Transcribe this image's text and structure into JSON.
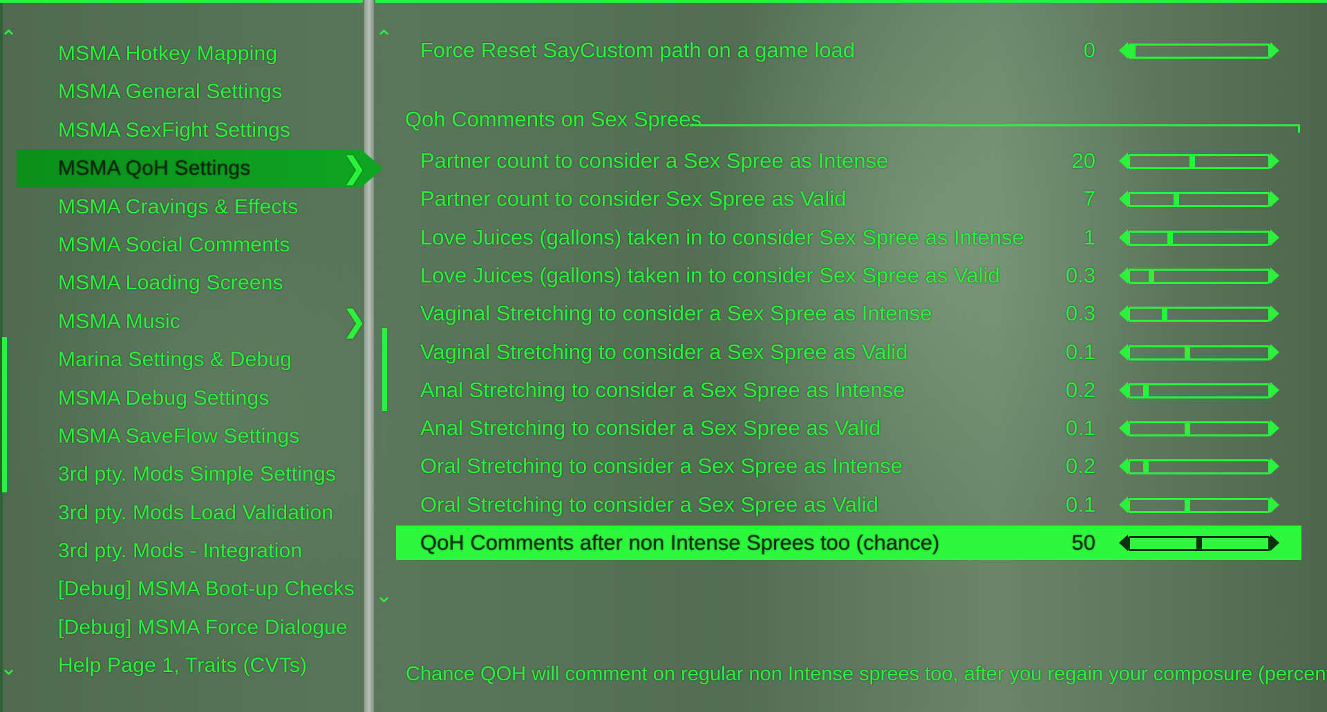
{
  "left_menu": {
    "items": [
      {
        "label": "MSMA Hotkey Mapping"
      },
      {
        "label": "MSMA General Settings"
      },
      {
        "label": "MSMA SexFight Settings"
      },
      {
        "label": "MSMA QoH Settings"
      },
      {
        "label": "MSMA Cravings & Effects"
      },
      {
        "label": "MSMA Social Comments"
      },
      {
        "label": "MSMA Loading Screens"
      },
      {
        "label": "MSMA Music"
      },
      {
        "label": "Marina Settings & Debug"
      },
      {
        "label": "MSMA Debug Settings"
      },
      {
        "label": "MSMA SaveFlow Settings"
      },
      {
        "label": "3rd pty. Mods Simple Settings"
      },
      {
        "label": "3rd pty. Mods Load Validation"
      },
      {
        "label": "3rd pty. Mods - Integration"
      },
      {
        "label": "[Debug] MSMA Boot-up Checks"
      },
      {
        "label": "[Debug] MSMA Force Dialogue"
      },
      {
        "label": "Help Page 1, Traits (CVTs)"
      }
    ],
    "selected_index": 3
  },
  "settings": {
    "top_row": {
      "label": "Force Reset SayCustom path on a game load",
      "value": "0",
      "slider_fraction": 0.0
    },
    "section_title": "Qoh Comments on Sex Sprees",
    "rows": [
      {
        "label": "Partner count to consider a Sex Spree as Intense",
        "value": "20",
        "slider_fraction": 0.45
      },
      {
        "label": "Partner count to consider Sex Spree as Valid",
        "value": "7",
        "slider_fraction": 0.33
      },
      {
        "label": "Love Juices (gallons) taken in to consider Sex Spree as Intense",
        "value": "1",
        "slider_fraction": 0.28
      },
      {
        "label": "Love Juices (gallons) taken in to consider Sex Spree as Valid",
        "value": "0.3",
        "slider_fraction": 0.14
      },
      {
        "label": "Vaginal Stretching to consider a Sex Spree as Intense",
        "value": "0.3",
        "slider_fraction": 0.24
      },
      {
        "label": "Vaginal Stretching to consider a Sex Spree as Valid",
        "value": "0.1",
        "slider_fraction": 0.41
      },
      {
        "label": "Anal Stretching to consider a Sex Spree as Intense",
        "value": "0.2",
        "slider_fraction": 0.1
      },
      {
        "label": "Anal Stretching to consider a Sex Spree as Valid",
        "value": "0.1",
        "slider_fraction": 0.41
      },
      {
        "label": "Oral Stretching to consider a Sex Spree as Intense",
        "value": "0.2",
        "slider_fraction": 0.1
      },
      {
        "label": "Oral Stretching to consider a Sex Spree as Valid",
        "value": "0.1",
        "slider_fraction": 0.41
      },
      {
        "label": "QoH Comments after non Intense Sprees too (chance)",
        "value": "50",
        "slider_fraction": 0.5
      }
    ],
    "selected_row_index": 10,
    "help_text": "Chance QOH will comment on regular non Intense sprees too, after you regain your composure (percent)"
  },
  "colors": {
    "accent": "#2af23a",
    "selected_bg": "#2df83c",
    "selected_menu_bg": "#0fa522"
  }
}
